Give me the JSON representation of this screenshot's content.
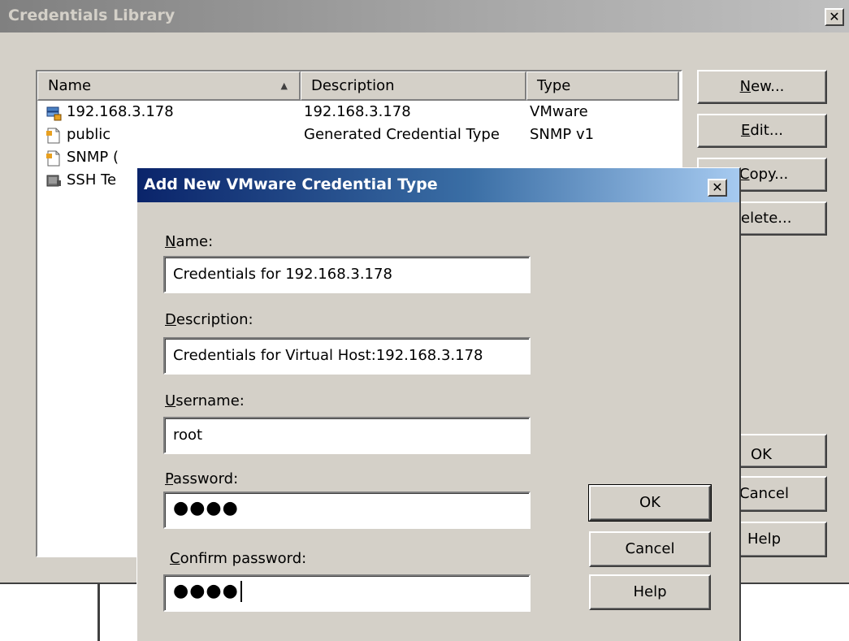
{
  "library": {
    "title": "Credentials Library",
    "close_label": "✕",
    "columns": [
      "Name",
      "Description",
      "Type"
    ],
    "rows": [
      {
        "name": "192.168.3.178",
        "description": "192.168.3.178",
        "type": "VMware",
        "icon": "vmware-host-icon"
      },
      {
        "name": "public",
        "description": "Generated Credential Type",
        "type": "SNMP v1",
        "icon": "document-icon"
      },
      {
        "name": "SNMP (",
        "description": "",
        "type": "",
        "icon": "document-icon"
      },
      {
        "name": "SSH Te",
        "description": "",
        "type": "",
        "icon": "terminal-icon"
      }
    ],
    "buttons": {
      "new": {
        "ul": "N",
        "rest": "ew..."
      },
      "edit": {
        "ul": "E",
        "rest": "dit..."
      },
      "copy": {
        "ul": "C",
        "rest": "opy..."
      },
      "delete": {
        "text": "elete..."
      },
      "ok": "OK",
      "cancel": "Cancel",
      "help": "Help"
    }
  },
  "dialog": {
    "title": "Add New VMware Credential Type",
    "close_label": "✕",
    "name": {
      "ul": "N",
      "rest": "ame:",
      "value": "Credentials for 192.168.3.178"
    },
    "description": {
      "ul": "D",
      "rest": "escription:",
      "value": "Credentials for Virtual Host:192.168.3.178"
    },
    "username": {
      "ul": "U",
      "rest": "sername:",
      "value": "root"
    },
    "password": {
      "ul": "P",
      "rest": "assword:",
      "value": "●●●●"
    },
    "confirm": {
      "ul": "C",
      "rest": "onfirm password:",
      "value": "●●●●"
    },
    "buttons": {
      "ok": "OK",
      "cancel": "Cancel",
      "help": "Help"
    }
  }
}
